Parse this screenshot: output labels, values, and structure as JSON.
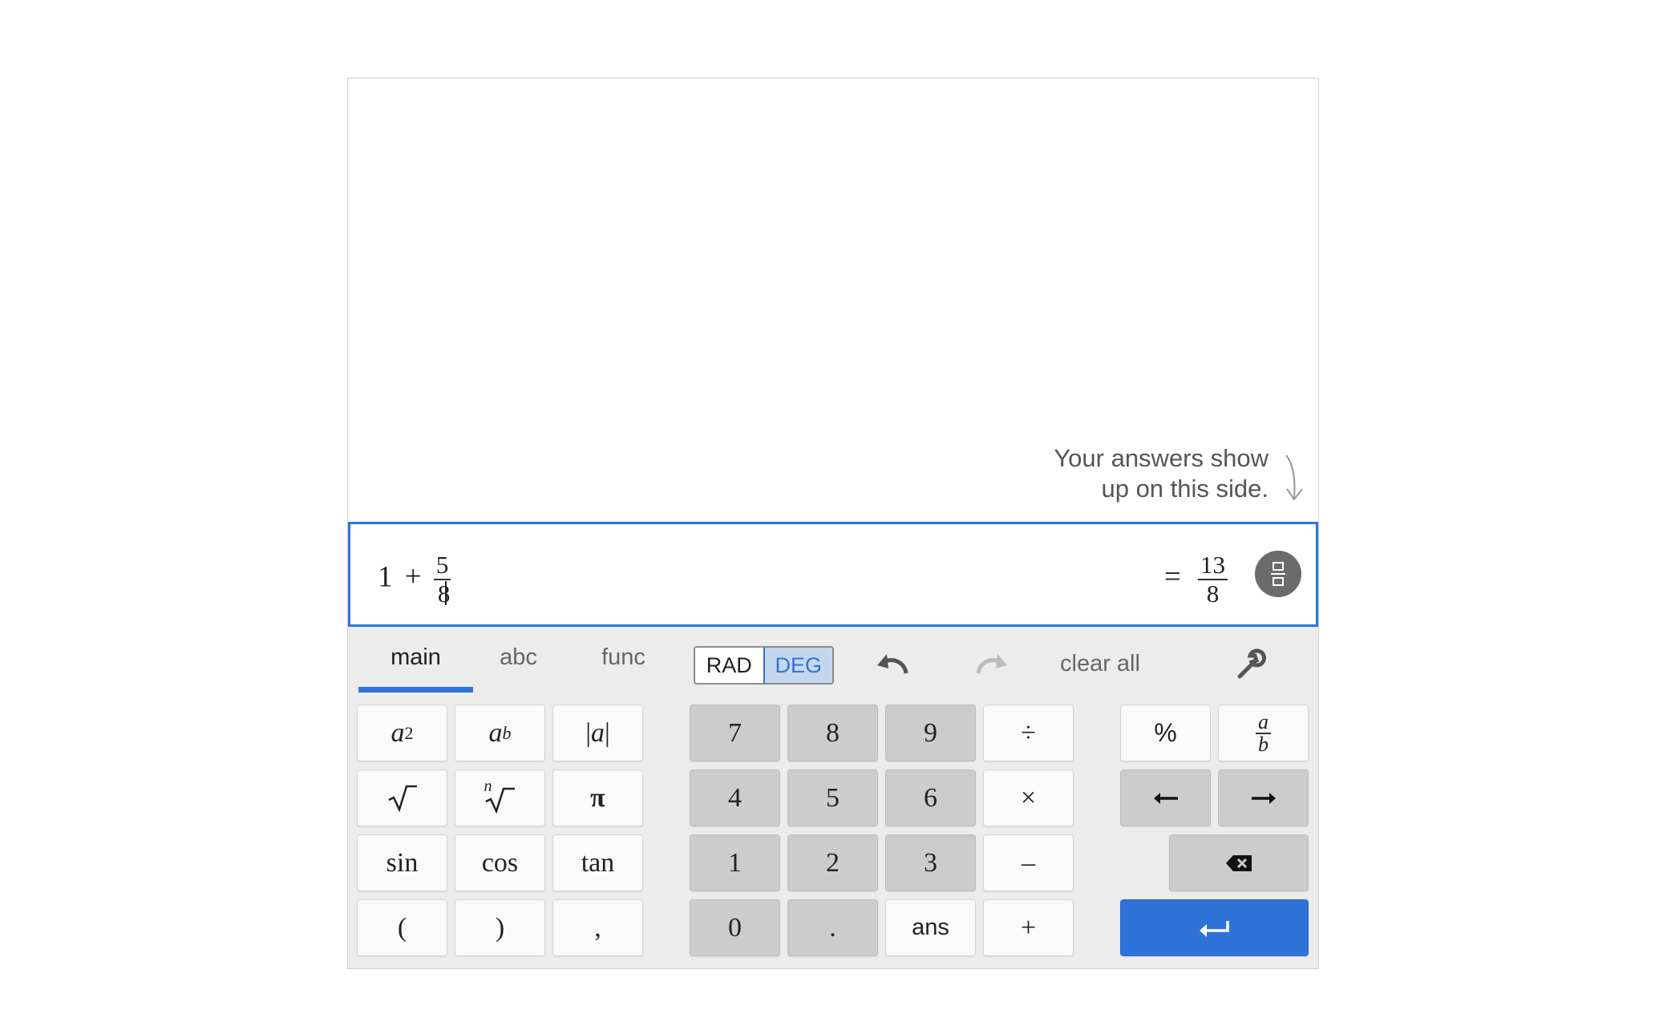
{
  "hint": {
    "line1": "Your answers show",
    "line2": "up on this side."
  },
  "expression": {
    "whole": "1",
    "op": "+",
    "numerator": "5",
    "denominator": "8"
  },
  "result": {
    "equals": "=",
    "numerator": "13",
    "denominator": "8"
  },
  "tabs": {
    "main": "main",
    "abc": "abc",
    "func": "func"
  },
  "angle": {
    "rad": "RAD",
    "deg": "DEG",
    "selected": "DEG"
  },
  "toolbar": {
    "clear_all": "clear all"
  },
  "keys": {
    "abs_bar": "|",
    "abs_a": "a",
    "pi": "π",
    "sin": "sin",
    "cos": "cos",
    "tan": "tan",
    "lparen": "(",
    "rparen": ")",
    "comma": ",",
    "seven": "7",
    "eight": "8",
    "nine": "9",
    "divide": "÷",
    "four": "4",
    "five": "5",
    "six": "6",
    "times": "×",
    "one": "1",
    "two": "2",
    "three": "3",
    "minus": "–",
    "zero": "0",
    "dot": ".",
    "ans": "ans",
    "plus": "+",
    "percent": "%",
    "frac_a": "a",
    "frac_b": "b",
    "sq_base": "a",
    "sq_exp": "2",
    "pow_base": "a",
    "pow_exp": "b",
    "nroot_n": "n"
  },
  "colors": {
    "accent": "#2f73d9",
    "gray_key": "#cccccc",
    "keypad_bg": "#ececec"
  },
  "icons": [
    "arrow-down-icon",
    "toggle-fraction-icon",
    "undo-icon",
    "redo-icon",
    "wrench-icon",
    "sqrt-icon",
    "nth-root-icon",
    "arrow-left-icon",
    "arrow-right-icon",
    "backspace-icon",
    "enter-icon"
  ]
}
